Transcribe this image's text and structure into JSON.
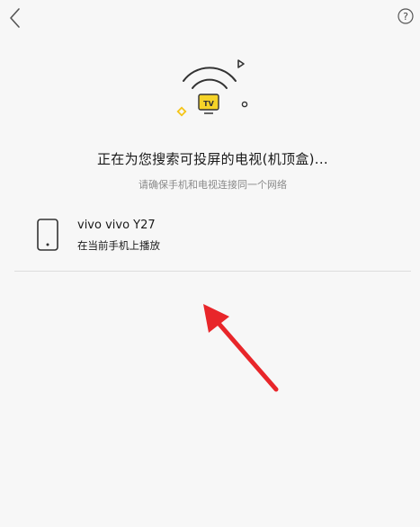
{
  "search": {
    "title": "正在为您搜索可投屏的电视(机顶盒)...",
    "subtitle": "请确保手机和电视连接同一个网络"
  },
  "illustration": {
    "tv_label": "TV",
    "accent": "#f5d328"
  },
  "devices": [
    {
      "name": "vivo  vivo Y27",
      "subtitle": "在当前手机上播放",
      "icon": "phone-icon"
    }
  ],
  "annotation": {
    "arrow_color": "#e8262a"
  }
}
